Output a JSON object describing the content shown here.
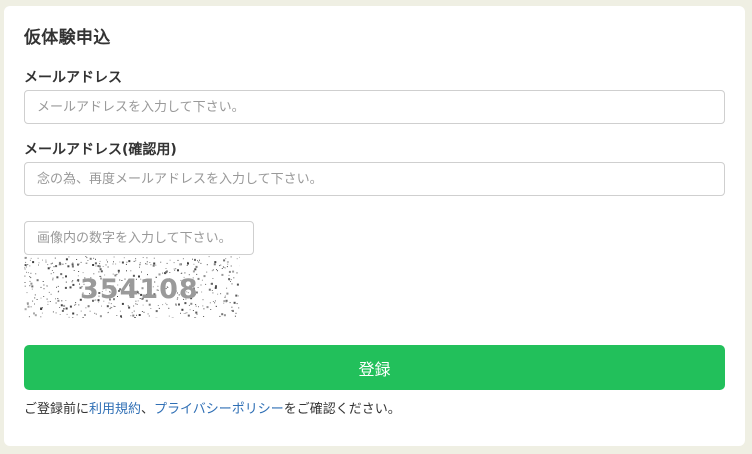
{
  "form": {
    "title": "仮体験申込",
    "email_label": "メールアドレス",
    "email_placeholder": "メールアドレスを入力して下さい。",
    "email_value": "",
    "email_confirm_label": "メールアドレス(確認用)",
    "email_confirm_placeholder": "念の為、再度メールアドレスを入力して下さい。",
    "email_confirm_value": "",
    "captcha_placeholder": "画像内の数字を入力して下さい。",
    "captcha_value": "",
    "captcha_text": "354108",
    "submit_label": "登録"
  },
  "agreement": {
    "prefix": "ご登録前に",
    "terms_link": "利用規約",
    "separator": "、",
    "privacy_link": "プライバシーポリシー",
    "suffix": "をご確認ください。"
  },
  "colors": {
    "page_background": "#efefe3",
    "card_background": "#ffffff",
    "submit_background": "#22c05b",
    "link": "#2f6fb5",
    "captcha_text": "#9a9a9a"
  }
}
